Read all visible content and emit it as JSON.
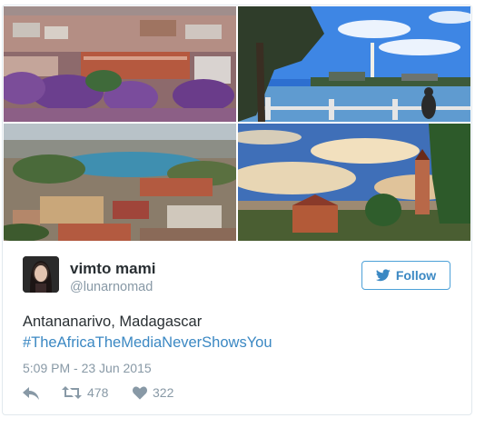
{
  "tweet": {
    "user": {
      "display_name": "vimto mami",
      "handle": "@lunarnomad"
    },
    "follow_label": "Follow",
    "text": "Antananarivo, Madagascar",
    "hashtag": "#TheAfricaTheMediaNeverShowsYou",
    "timestamp": "5:09 PM - 23 Jun 2015",
    "retweet_count": "478",
    "like_count": "322"
  },
  "colors": {
    "link_blue": "#3b88c3",
    "muted_gray": "#8899a6",
    "text_dark": "#292f33",
    "border": "#e1e8ed"
  },
  "icons": [
    "twitter-bird-icon",
    "reply-icon",
    "retweet-icon",
    "heart-icon"
  ]
}
